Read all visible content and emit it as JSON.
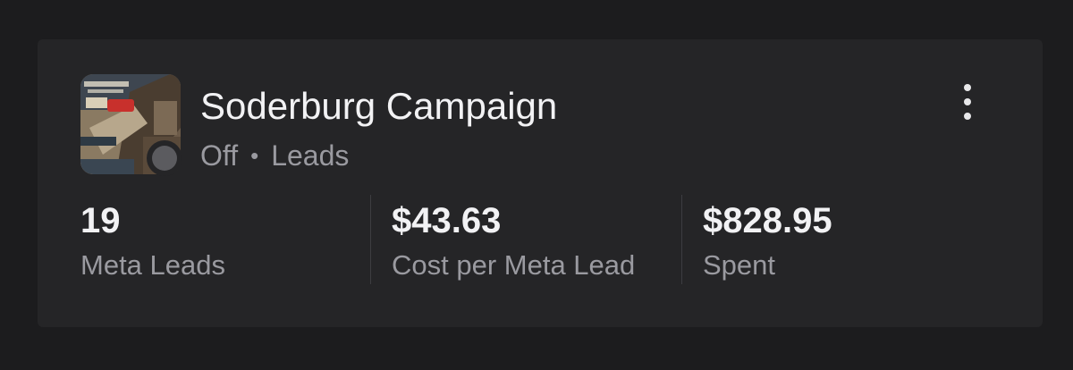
{
  "campaign": {
    "name": "Soderburg Campaign",
    "status": "Off",
    "separator": "•",
    "objective": "Leads",
    "status_color": "#5b5b5f"
  },
  "metrics": [
    {
      "value": "19",
      "label": "Meta Leads"
    },
    {
      "value": "$43.63",
      "label": "Cost per Meta Lead"
    },
    {
      "value": "$828.95",
      "label": "Spent"
    }
  ],
  "icons": {
    "more": "more-vertical-icon",
    "status": "status-off-dot"
  },
  "colors": {
    "background": "#1c1c1e",
    "card": "#252527",
    "primary_text": "#f2f2f4",
    "secondary_text": "#9a9aa0"
  }
}
